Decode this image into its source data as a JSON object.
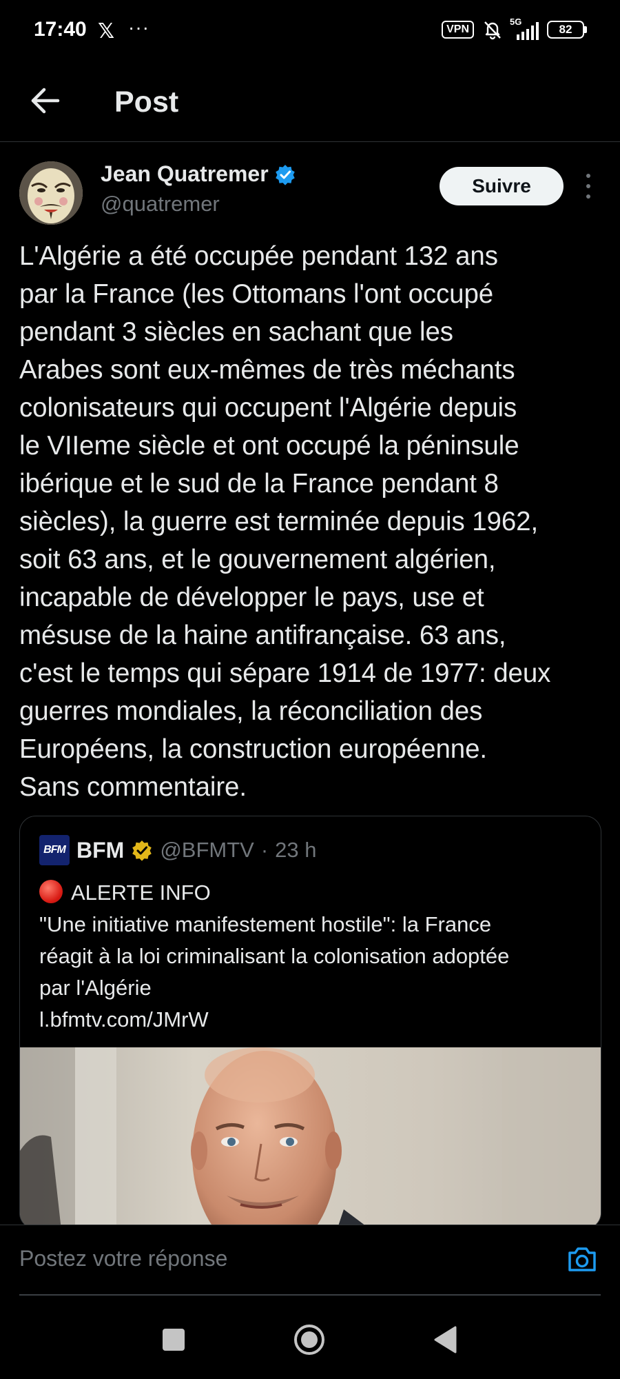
{
  "status_bar": {
    "time": "17:40",
    "x_glyph": "𝕏",
    "dots": "···",
    "vpn": "VPN",
    "network": "5G",
    "battery": "82",
    "icons": [
      "x-logo-icon",
      "more-dots-icon",
      "vpn-icon",
      "bell-muted-icon",
      "signal-icon",
      "battery-icon"
    ]
  },
  "header": {
    "title": "Post",
    "back_icon": "arrow-left-icon"
  },
  "author": {
    "name": "Jean Quatremer",
    "handle": "@quatremer",
    "verified_color": "#1d9bf0",
    "follow_label": "Suivre"
  },
  "post": {
    "lines": [
      "L'Algérie a été occupée pendant 132 ans",
      "par la France (les Ottomans l'ont occupé",
      "pendant 3 siècles en sachant que les",
      "Arabes sont eux-mêmes de très méchants",
      "colonisateurs qui occupent l'Algérie depuis",
      "le VIIeme siècle et ont occupé la péninsule",
      "ibérique et le sud de la France pendant 8",
      "siècles), la guerre est terminée depuis 1962,",
      "soit 63 ans, et le gouvernement algérien,",
      "incapable de développer le pays, use et",
      "mésuse de la haine antifrançaise. 63 ans,",
      "c'est le temps qui sépare 1914 de 1977: deux",
      "guerres mondiales, la réconciliation des",
      "Européens, la construction européenne.",
      "Sans commentaire."
    ]
  },
  "quote": {
    "logo_text": "BFM",
    "name": "BFM",
    "badge_color": "#e2b719",
    "handle": "@BFMTV",
    "separator": "·",
    "time": "23 h",
    "alert_label": "ALERTE INFO",
    "lines": [
      "\"Une initiative manifestement hostile\": la France",
      "réagit à la loi criminalisant la colonisation adoptée",
      "par l'Algérie",
      "l.bfmtv.com/JMrW"
    ]
  },
  "reply": {
    "placeholder": "Postez votre réponse",
    "camera_icon": "camera-icon",
    "accent": "#1d9bf0"
  },
  "nav": {
    "icons": [
      "recents-square-icon",
      "home-circle-icon",
      "back-triangle-icon"
    ]
  }
}
